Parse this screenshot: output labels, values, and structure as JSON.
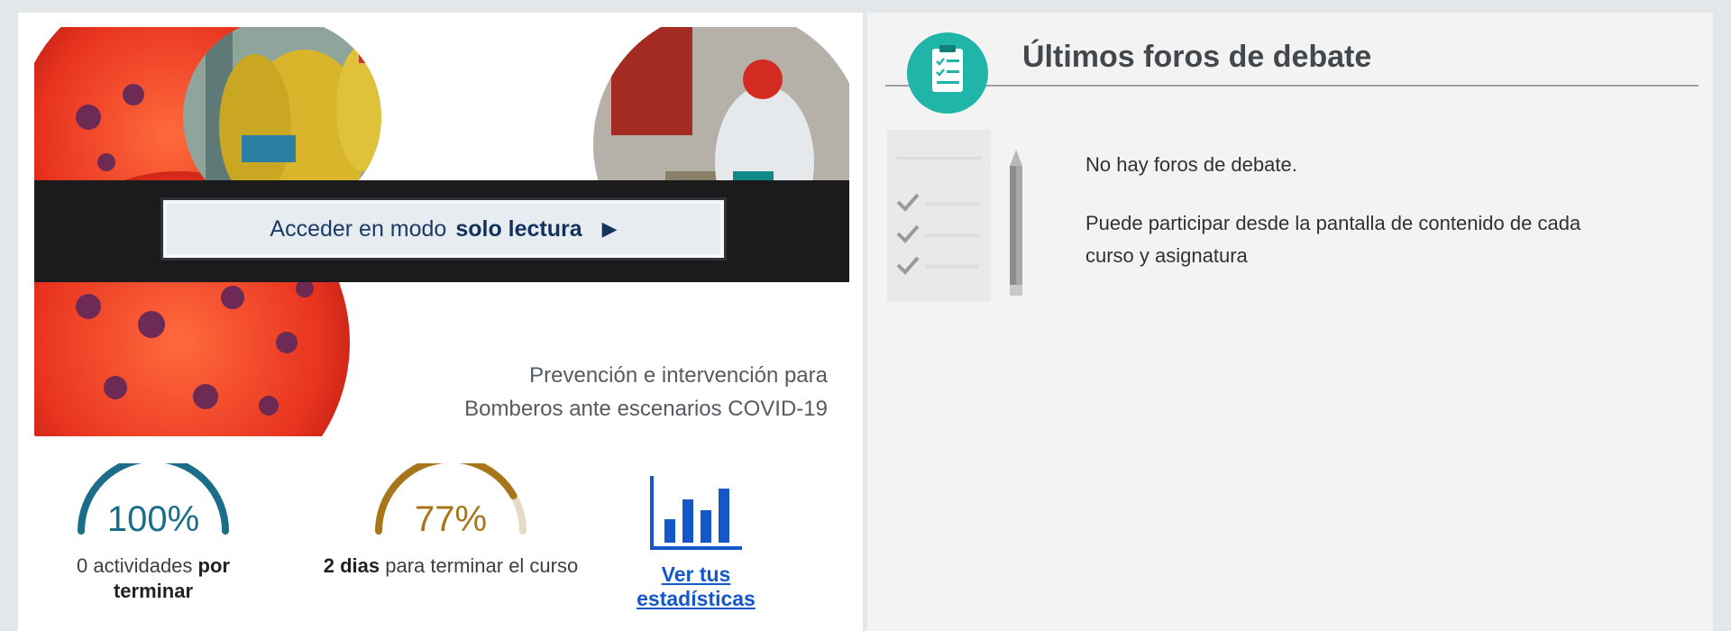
{
  "course": {
    "access_button": {
      "prefix": "Acceder en modo",
      "emphasis": "solo lectura",
      "icon": "play-icon"
    },
    "title_line1": "Prevención e intervención para",
    "title_line2": "Bomberos ante escenarios COVID-19"
  },
  "stats": {
    "activities": {
      "value": "100%",
      "progress": 1.0,
      "color": "#1c6d8a",
      "count": "0 actividades",
      "bold": "por terminar"
    },
    "course_time": {
      "value": "77%",
      "progress": 0.77,
      "color": "#a7761a",
      "days": "2 dias",
      "rest": "para terminar el curso"
    },
    "link": {
      "label1": "Ver tus",
      "label2": "estadísticas",
      "icon": "bar-chart-icon",
      "color": "#1357c8"
    }
  },
  "forums": {
    "title": "Últimos foros de debate",
    "icon": "checklist-icon",
    "accent": "#1fb5a8",
    "empty_message": "No hay foros de debate.",
    "hint_line1": "Puede participar desde la pantalla de contenido de cada",
    "hint_line2": "curso y asignatura"
  }
}
